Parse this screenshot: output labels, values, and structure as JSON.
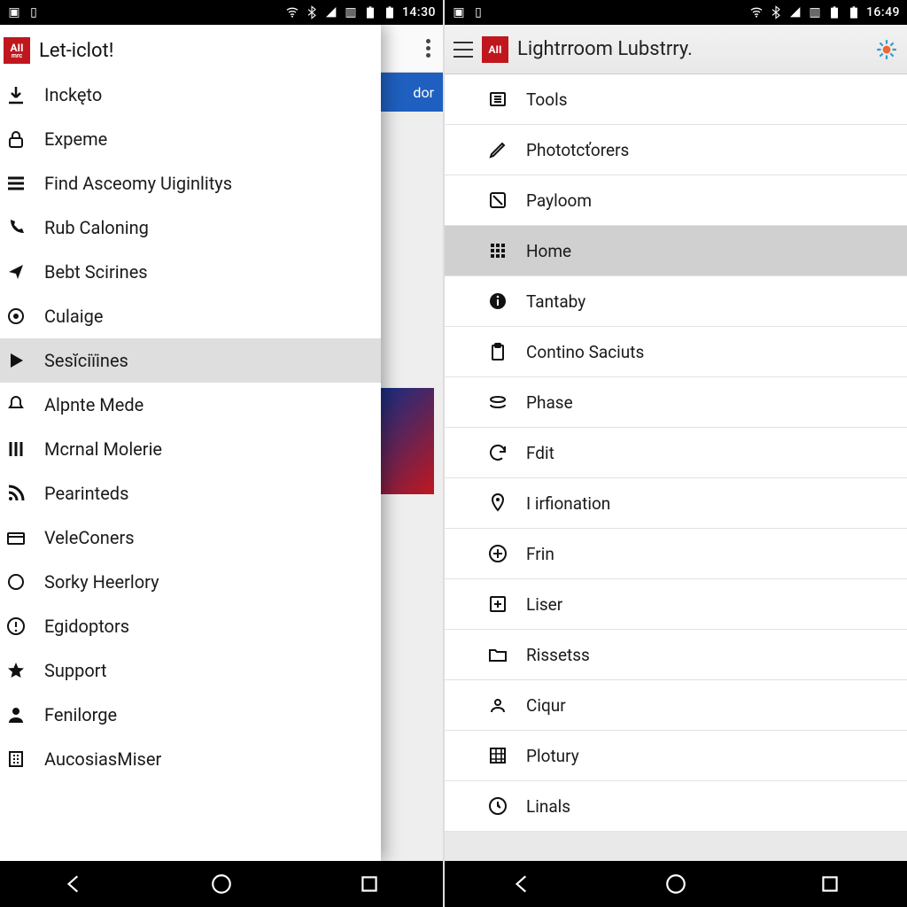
{
  "left": {
    "statusbar": {
      "time": "14:30"
    },
    "drawer_title": "Let-iclot!",
    "behind_blue_label": "dor",
    "menu": [
      {
        "label": "Inckęto",
        "icon": "download-icon",
        "selected": false
      },
      {
        "label": "Expeme",
        "icon": "lock-icon",
        "selected": false
      },
      {
        "label": "Find Asceomy Uiginlitys",
        "icon": "lines-icon",
        "selected": false
      },
      {
        "label": "Rub Caloning",
        "icon": "phone-icon",
        "selected": false
      },
      {
        "label": "Bebt Scirines",
        "icon": "share-icon",
        "selected": false
      },
      {
        "label": "Culaige",
        "icon": "target-icon",
        "selected": false
      },
      {
        "label": "Sesĭciïines",
        "icon": "play-icon",
        "selected": true
      },
      {
        "label": "Alpnte Mede",
        "icon": "bell-icon",
        "selected": false
      },
      {
        "label": "Mcrnal Molerie",
        "icon": "columns-icon",
        "selected": false
      },
      {
        "label": "Pearinteds",
        "icon": "rss-icon",
        "selected": false
      },
      {
        "label": "VeleConers",
        "icon": "card-icon",
        "selected": false
      },
      {
        "label": "Sorky Heerlory",
        "icon": "circle-icon",
        "selected": false
      },
      {
        "label": "Egidoptors",
        "icon": "alert-icon",
        "selected": false
      },
      {
        "label": "Support",
        "icon": "star-icon",
        "selected": false
      },
      {
        "label": "Fenilorge",
        "icon": "person-icon",
        "selected": false
      },
      {
        "label": "AucosiasMiser",
        "icon": "building-icon",
        "selected": false
      }
    ]
  },
  "right": {
    "statusbar": {
      "time": "16:49"
    },
    "header_title": "Lightrroom Lubstrry.",
    "menu": [
      {
        "label": "Tools",
        "icon": "list-icon",
        "selected": false
      },
      {
        "label": "Phototcťorers",
        "icon": "pencil-icon",
        "selected": false
      },
      {
        "label": "Payloom",
        "icon": "checkbox-icon",
        "selected": false
      },
      {
        "label": "Home",
        "icon": "grid-icon",
        "selected": true
      },
      {
        "label": "Tantaby",
        "icon": "info-icon",
        "selected": false
      },
      {
        "label": "Contino Saciuts",
        "icon": "clipboard-icon",
        "selected": false
      },
      {
        "label": "Phase",
        "icon": "stack-icon",
        "selected": false
      },
      {
        "label": "Fdit",
        "icon": "refresh-icon",
        "selected": false
      },
      {
        "label": "I irfionation",
        "icon": "pin-icon",
        "selected": false
      },
      {
        "label": "Frin",
        "icon": "plus-circle-icon",
        "selected": false
      },
      {
        "label": "Liser",
        "icon": "add-box-icon",
        "selected": false
      },
      {
        "label": "Rissetss",
        "icon": "folder-icon",
        "selected": false
      },
      {
        "label": "Ciqur",
        "icon": "user-icon",
        "selected": false
      },
      {
        "label": "Plotury",
        "icon": "table-icon",
        "selected": false
      },
      {
        "label": "Linals",
        "icon": "clock-icon",
        "selected": false
      }
    ]
  },
  "brand_text": "AII"
}
